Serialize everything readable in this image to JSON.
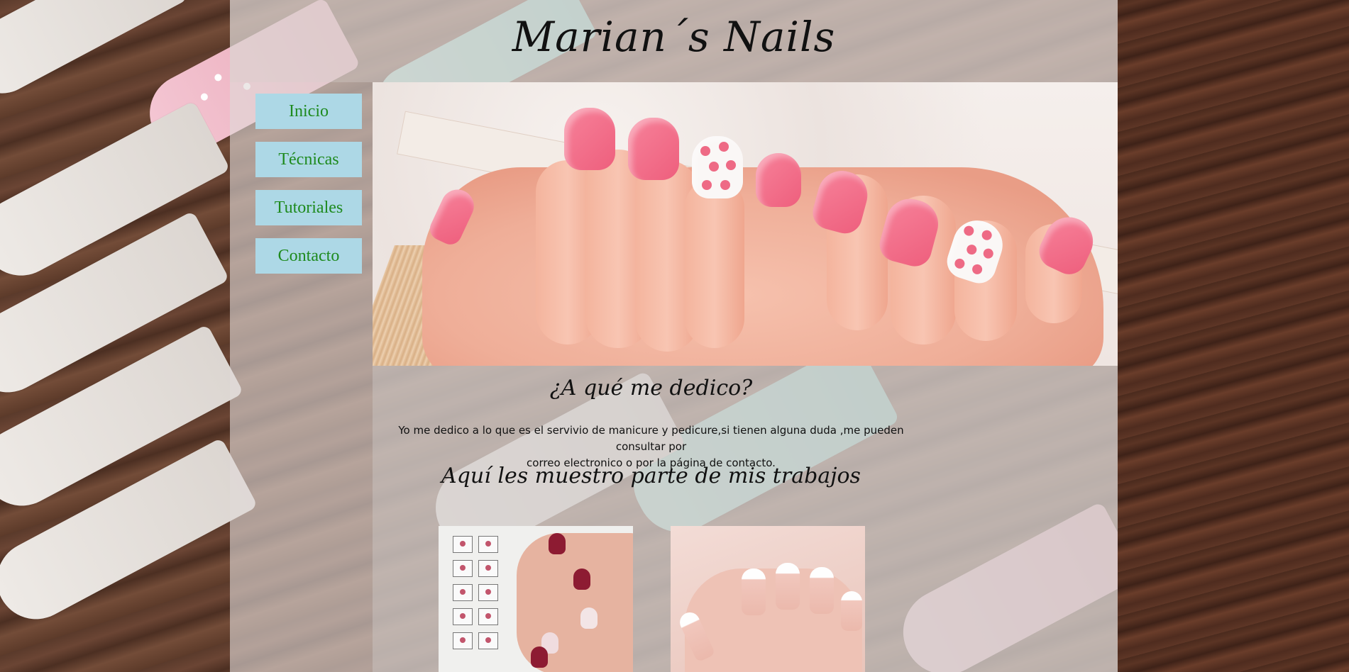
{
  "site": {
    "title": "Marian´s Nails"
  },
  "nav": {
    "items": [
      {
        "label": "Inicio"
      },
      {
        "label": "Técnicas"
      },
      {
        "label": "Tutoriales"
      },
      {
        "label": "Contacto"
      }
    ]
  },
  "about": {
    "title": "¿A qué me dedico?",
    "text_line1": "Yo me dedico a lo que es el servivio de manicure y pedicure,si tienen alguna duda ,me pueden consultar por",
    "text_line2": "correo electronico o por la página de contacto."
  },
  "works": {
    "title": "Aquí les muestro parte de mis trabajos"
  },
  "colors": {
    "nav_bg": "#add8e6",
    "nav_text": "#1e8a1e",
    "nail_pink": "#ee5f7d",
    "nail_burgundy": "#8d1b32"
  }
}
